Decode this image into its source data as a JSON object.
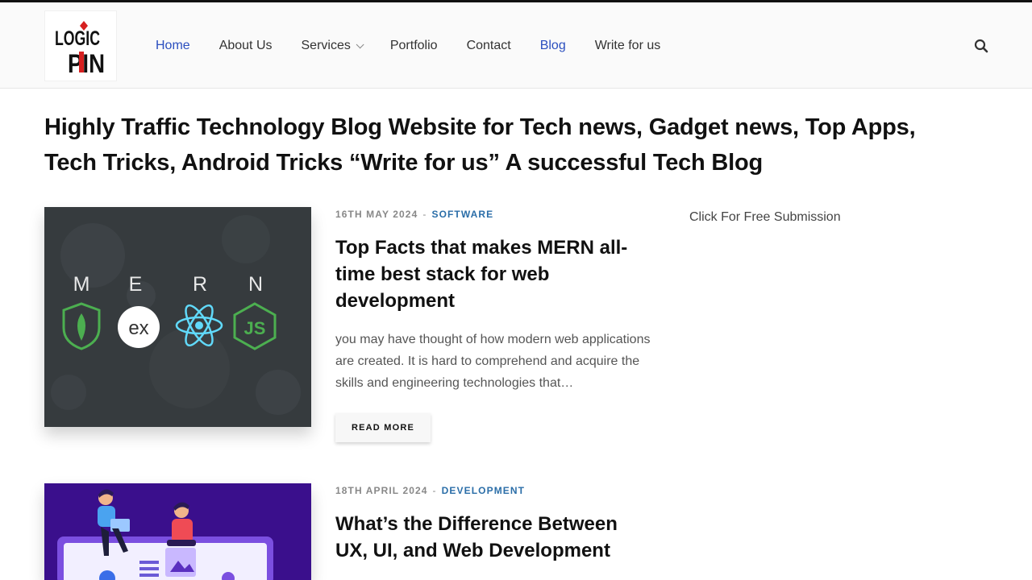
{
  "site": {
    "logo_text_top": "LOGIC",
    "logo_text_bottom": "PIN"
  },
  "nav": {
    "items": [
      {
        "label": "Home",
        "active": true
      },
      {
        "label": "About Us",
        "active": false
      },
      {
        "label": "Services",
        "active": false,
        "dropdown": true
      },
      {
        "label": "Portfolio",
        "active": false
      },
      {
        "label": "Contact",
        "active": false
      },
      {
        "label": "Blog",
        "active": true
      },
      {
        "label": "Write for us",
        "active": false
      }
    ],
    "search_icon": "search-icon"
  },
  "page_title": "Highly Traffic Technology Blog Website for Tech news, Gadget news, Top Apps, Tech Tricks, Android Tricks “Write for us” A successful Tech Blog",
  "sidebar": {
    "link": "Click For Free Submission"
  },
  "posts": [
    {
      "date": "16TH MAY 2024",
      "category": "SOFTWARE",
      "title": "Top Facts that makes MERN all-time best stack for web development",
      "excerpt": "you may have thought of how modern web applications are created. It is hard to comprehend and acquire the skills and engineering technologies that…",
      "read_more": "READ MORE",
      "thumb": {
        "letters": [
          "M",
          "E",
          "R",
          "N"
        ],
        "express_label": "ex"
      }
    },
    {
      "date": "18TH APRIL 2024",
      "category": "DEVELOPMENT",
      "title": "What’s the Difference Between UX, UI, and Web Development"
    }
  ],
  "colors": {
    "accent": "#2b4fbf",
    "category": "#2b6ea8",
    "thumb1_bg": "#363b3e",
    "thumb2_bg": "#3a0f8c"
  }
}
